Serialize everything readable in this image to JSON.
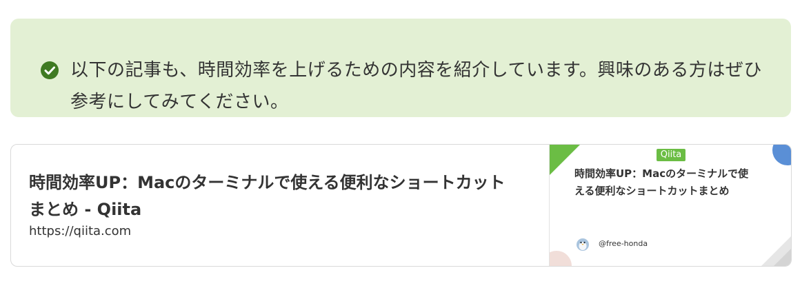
{
  "callout": {
    "icon": "check-circle-icon",
    "line1": "以下の記事も、時間効率を上げるための内容を紹介しています。興味のある方はぜひ",
    "line2": "参考にしてみてください。",
    "background_color": "#e3f0d4",
    "icon_color": "#3f7a22"
  },
  "link_card": {
    "title_line1": "時間効率UP：Macのターミナルで使える便利なショートカット",
    "title_line2": "まとめ - Qiita",
    "url": "https://qiita.com",
    "thumbnail": {
      "badge": "Qiita",
      "title_line1": "時間効率UP：Macのターミナルで使",
      "title_line2": "える便利なショートカットまとめ",
      "author": "@free-honda",
      "avatar_icon": "penguin-avatar-icon",
      "accent_green": "#6bbd44",
      "accent_blue": "#5a8fd6"
    }
  }
}
